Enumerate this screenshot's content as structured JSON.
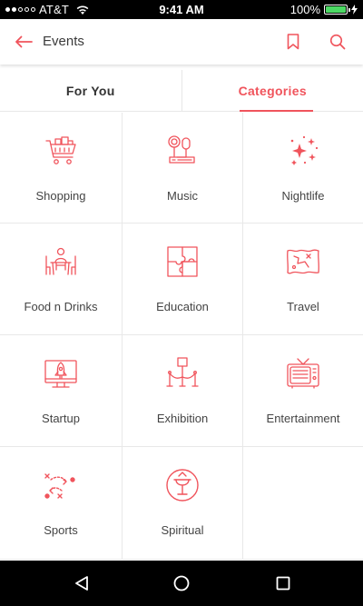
{
  "status_bar": {
    "carrier": "AT&T",
    "time": "9:41 AM",
    "battery": "100%",
    "battery_level": 1.0,
    "signal_bars_filled": 2,
    "signal_bars_total": 5
  },
  "header": {
    "title": "Events",
    "back_icon": "arrow-left-icon",
    "bookmark_icon": "bookmark-icon",
    "search_icon": "search-icon"
  },
  "tabs": [
    {
      "label": "For You",
      "active": false
    },
    {
      "label": "Categories",
      "active": true
    }
  ],
  "categories": [
    {
      "label": "Shopping",
      "icon": "shopping-cart-icon"
    },
    {
      "label": "Music",
      "icon": "headphones-icon"
    },
    {
      "label": "Nightlife",
      "icon": "sparkles-icon"
    },
    {
      "label": "Food n Drinks",
      "icon": "dining-icon"
    },
    {
      "label": "Education",
      "icon": "puzzle-icon"
    },
    {
      "label": "Travel",
      "icon": "map-icon"
    },
    {
      "label": "Startup",
      "icon": "rocket-monitor-icon"
    },
    {
      "label": "Exhibition",
      "icon": "exhibit-stand-icon"
    },
    {
      "label": "Entertainment",
      "icon": "tv-icon"
    },
    {
      "label": "Sports",
      "icon": "sports-play-icon"
    },
    {
      "label": "Spiritual",
      "icon": "spiritual-symbol-icon"
    }
  ],
  "colors": {
    "accent": "#f0545c",
    "text": "#444444",
    "divider": "#e8e8e8",
    "battery": "#4cd964"
  },
  "nav_bar": {
    "back_icon": "triangle-back-icon",
    "home_icon": "circle-home-icon",
    "recent_icon": "square-recent-icon"
  }
}
